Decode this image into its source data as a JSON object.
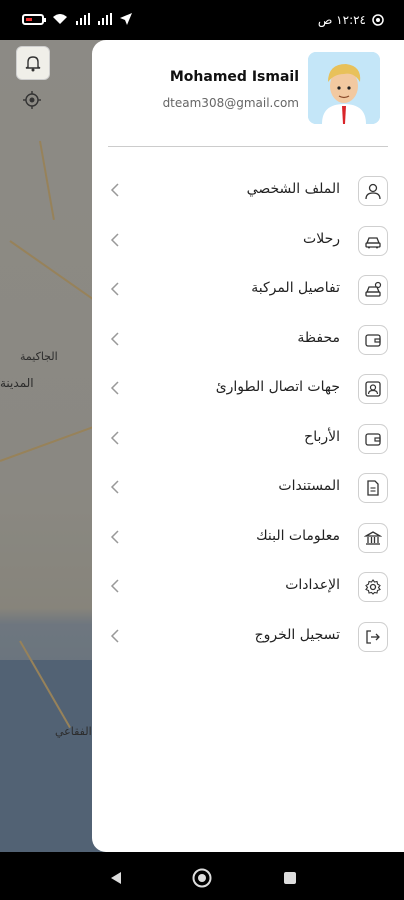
{
  "status": {
    "time": "١٢:٢٤ ص"
  },
  "map": {
    "labels": [
      "الجاكيمة",
      "المدينة",
      "الفقاعي"
    ]
  },
  "profile": {
    "name": "Mohamed Ismail",
    "email": "dteam308@gmail.com"
  },
  "menu": {
    "items": [
      {
        "label": "الملف الشخصي",
        "icon": "user-icon"
      },
      {
        "label": "رحلات",
        "icon": "car-icon"
      },
      {
        "label": "تفاصيل المركبة",
        "icon": "vehicle-details-icon"
      },
      {
        "label": "محفظة",
        "icon": "wallet-icon"
      },
      {
        "label": "جهات اتصال الطوارئ",
        "icon": "contact-icon"
      },
      {
        "label": "الأرباح",
        "icon": "earnings-wallet-icon"
      },
      {
        "label": "المستندات",
        "icon": "document-icon"
      },
      {
        "label": "معلومات البنك",
        "icon": "bank-icon"
      },
      {
        "label": "الإعدادات",
        "icon": "gear-icon"
      },
      {
        "label": "تسجيل الخروج",
        "icon": "logout-icon"
      }
    ]
  }
}
